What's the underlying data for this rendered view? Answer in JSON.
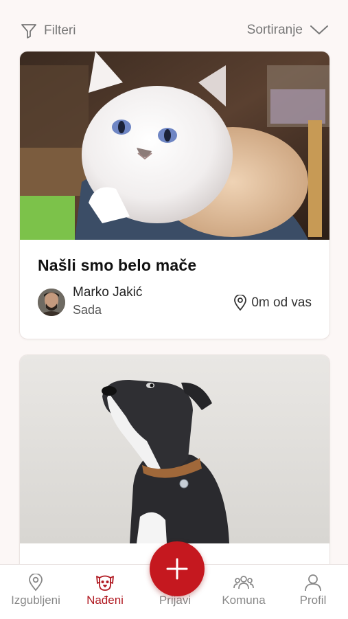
{
  "topbar": {
    "filter_label": "Filteri",
    "sort_label": "Sortiranje"
  },
  "posts": [
    {
      "title": "Našli smo belo mače",
      "author": "Marko Jakić",
      "time": "Sada",
      "distance": "0m od vas",
      "photo": "white-kitten-photo"
    },
    {
      "title": "",
      "photo": "black-dog-photo"
    }
  ],
  "nav": {
    "items": [
      {
        "label": "Izgubljeni",
        "icon": "location-pin-icon"
      },
      {
        "label": "Nađeni",
        "icon": "dog-face-icon"
      },
      {
        "label": "Prijavi",
        "icon": "plus-icon"
      },
      {
        "label": "Komuna",
        "icon": "community-icon"
      },
      {
        "label": "Profil",
        "icon": "user-icon"
      }
    ],
    "active_index": 1
  },
  "colors": {
    "accent": "#c5181f",
    "active_nav": "#b01820",
    "background": "#fcf7f6",
    "muted_text": "#777777"
  }
}
